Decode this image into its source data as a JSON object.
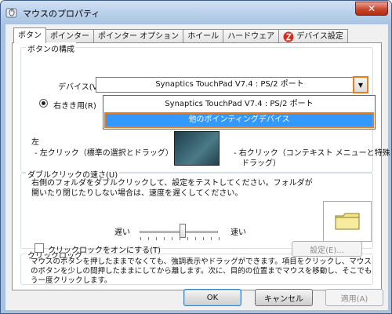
{
  "window": {
    "title": "マウスのプロパティ",
    "close_symbol": "✕"
  },
  "tabs": [
    {
      "label": "ボタン",
      "active": true
    },
    {
      "label": "ポインター"
    },
    {
      "label": "ポインター オプション"
    },
    {
      "label": "ホイール"
    },
    {
      "label": "ハードウェア"
    },
    {
      "label": "デバイス設定"
    }
  ],
  "button_config": {
    "group_label": "ボタンの構成",
    "device_label": "デバイス(V):",
    "device_value": "Synaptics TouchPad V7.4 : PS/2 ポート",
    "dropdown_options": [
      "Synaptics TouchPad V7.4 : PS/2 ポート",
      "他のポインティングデバイス"
    ],
    "right_handed_label": "右きき用(R)",
    "left_label": "左",
    "left_click_desc": "- 左クリック（標準の選択とドラッグ）",
    "right_click_desc_1": "- 右クリック（コンテキスト メニューと特殊",
    "right_click_desc_2": "ドラッグ）"
  },
  "double_click": {
    "group_label": "ダブルクリックの速さ(U)",
    "description": "右側のフォルダをダブルクリックして、設定をテストしてください。フォルダが開いたり閉じたりしない場合は、速度を遅くしてください。",
    "slow_label": "遅い",
    "fast_label": "速い",
    "speed_fraction": 0.55
  },
  "click_lock": {
    "group_label": "クリックロック",
    "checkbox_label": "クリックロックをオンにする(T)",
    "checked": false,
    "settings_button": "設定(E)...",
    "description": "マウスのボタンを押したままでなくても、強調表示やドラッグができます。項目をクリックし、マウスのボタンを少しの間押したままにしてから離します。次に、目的の位置までマウスを移動し、そこでもう一度クリックします。"
  },
  "footer": {
    "ok": "OK",
    "cancel": "キャンセル",
    "apply": "適用(A)"
  },
  "colors": {
    "highlight": "#f07c17",
    "selection": "#3399ff",
    "folder": "#f3e487"
  },
  "icons": [
    "mouse-icon",
    "close-icon",
    "synaptics-icon",
    "chevron-down-icon",
    "folder-icon"
  ]
}
